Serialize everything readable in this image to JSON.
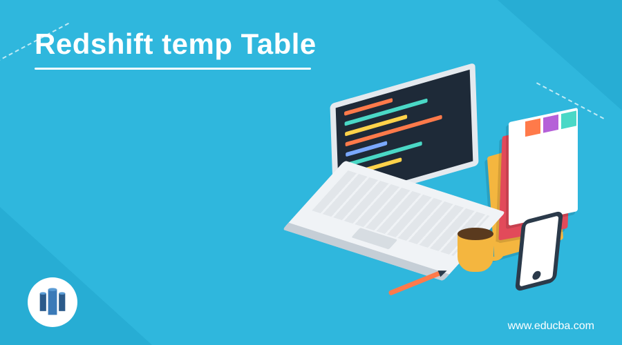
{
  "title": "Redshift temp Table",
  "url": "www.educba.com",
  "logo": "redshift-database",
  "colors": {
    "background": "#2fb7dd",
    "accent": "#1a9bc4",
    "text": "#ffffff"
  }
}
